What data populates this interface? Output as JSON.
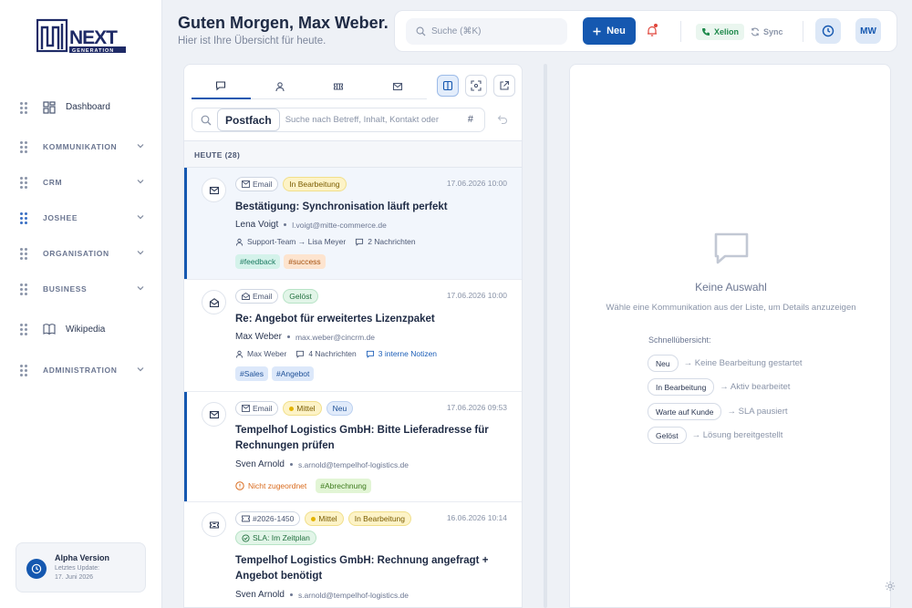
{
  "logo": {
    "text": "NEXT",
    "sub": "GENERATION"
  },
  "sidebar": {
    "items": [
      {
        "label": "Dashboard",
        "type": "link",
        "icon": "grid-icon"
      },
      {
        "label": "KOMMUNIKATION",
        "type": "section"
      },
      {
        "label": "CRM",
        "type": "section"
      },
      {
        "label": "JOSHEE",
        "type": "section"
      },
      {
        "label": "ORGANISATION",
        "type": "section"
      },
      {
        "label": "BUSINESS",
        "type": "section"
      },
      {
        "label": "Wikipedia",
        "type": "link",
        "icon": "book-icon"
      },
      {
        "label": "ADMINISTRATION",
        "type": "section"
      }
    ],
    "version": {
      "title": "Alpha Version",
      "line1": "Letztes Update:",
      "line2": "17. Juni 2026"
    }
  },
  "header": {
    "greeting": "Guten Morgen, Max Weber.",
    "subtitle": "Hier ist Ihre Übersicht für heute.",
    "search_placeholder": "Suche (⌘K)",
    "new_label": "Neu",
    "xelion_label": "Xelion",
    "sync_label": "Sync",
    "avatar_initials": "MW"
  },
  "list": {
    "tabs": [
      "chat-icon",
      "person-icon",
      "ticket-icon",
      "mail-icon"
    ],
    "folder": "Postfach",
    "search_placeholder": "Suche nach Betreff, Inhalt, Kontakt oder",
    "hash": "#",
    "group_header": "HEUTE (28)",
    "items": [
      {
        "type_label": "Email",
        "badges": [
          {
            "text": "In Bearbeitung",
            "style": "yel"
          }
        ],
        "date": "17.06.2026 10:00",
        "subject": "Bestätigung: Synchronisation läuft perfekt",
        "sender": "Lena Voigt",
        "email": "l.voigt@mitte-commerce.de",
        "meta_team": "Support-Team → Lisa Meyer",
        "meta_messages": "2 Nachrichten",
        "tags": [
          {
            "text": "#feedback",
            "style": "t-teal"
          },
          {
            "text": "#success",
            "style": "t-orange"
          }
        ]
      },
      {
        "type_label": "Email",
        "badges": [
          {
            "text": "Gelöst",
            "style": "grn"
          }
        ],
        "date": "17.06.2026 10:00",
        "subject": "Re: Angebot für erweitertes Lizenzpaket",
        "sender": "Max Weber",
        "email": "max.weber@cincrm.de",
        "meta_team": "Max Weber",
        "meta_messages": "4 Nachrichten",
        "meta_notes": "3 interne Notizen",
        "tags": [
          {
            "text": "#Sales",
            "style": "t-blue"
          },
          {
            "text": "#Angebot",
            "style": "t-blue"
          }
        ]
      },
      {
        "type_label": "Email",
        "badges": [
          {
            "text": "Mittel",
            "style": "yel"
          },
          {
            "text": "Neu",
            "style": "blu"
          }
        ],
        "date": "17.06.2026 09:53",
        "subject": "Tempelhof Logistics GmbH: Bitte Lieferadresse für Rechnungen prüfen",
        "sender": "Sven Arnold",
        "email": "s.arnold@tempelhof-logistics.de",
        "meta_warn": "Nicht zugeordnet",
        "tags": [
          {
            "text": "#Abrechnung",
            "style": "t-lime"
          }
        ]
      },
      {
        "type_label": "#2026-1450",
        "badges": [
          {
            "text": "Mittel",
            "style": "yel"
          },
          {
            "text": "In Bearbeitung",
            "style": "yel"
          }
        ],
        "sla": "SLA: Im Zeitplan",
        "date": "16.06.2026 10:14",
        "subject": "Tempelhof Logistics GmbH: Rechnung angefragt + Angebot benötigt",
        "sender": "Sven Arnold",
        "email": "s.arnold@tempelhof-logistics.de"
      }
    ]
  },
  "detail": {
    "empty_title": "Keine Auswahl",
    "empty_sub": "Wähle eine Kommunikation aus der Liste, um Details anzuzeigen",
    "quick_header": "Schnellübersicht:",
    "quick": [
      {
        "chip": "Neu",
        "desc": "→ Keine Bearbeitung gestartet"
      },
      {
        "chip": "In Bearbeitung",
        "desc": "→ Aktiv bearbeitet"
      },
      {
        "chip": "Warte auf Kunde",
        "desc": "→ SLA pausiert"
      },
      {
        "chip": "Gelöst",
        "desc": "→ Lösung bereitgestellt"
      }
    ]
  },
  "colors": {
    "accent": "#1558b0",
    "xelion": "#1f8a4c",
    "warn": "#d96b1e"
  }
}
